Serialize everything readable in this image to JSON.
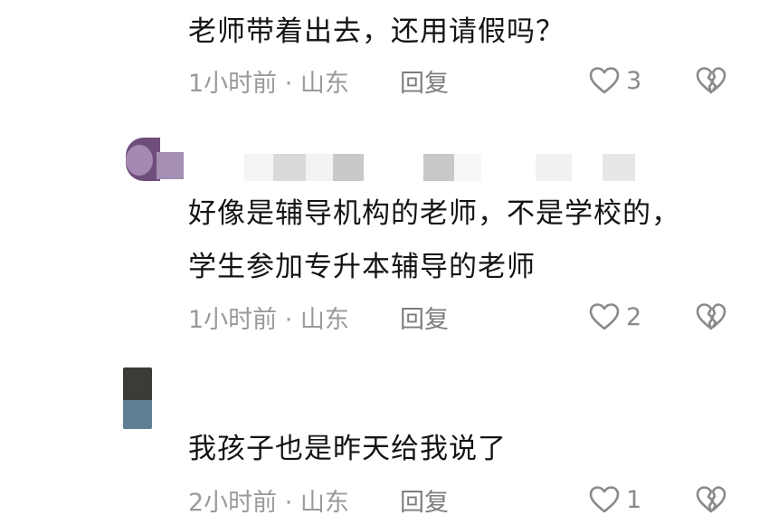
{
  "comments": [
    {
      "text_lines": [
        "老师带着出去，还用请假吗？"
      ],
      "time_location": "1小时前 · 山东",
      "reply_label": "回复",
      "like_count": "3"
    },
    {
      "text_lines": [
        "好像是辅导机构的老师，不是学校的，",
        "学生参加专升本辅导的老师"
      ],
      "time_location": "1小时前 · 山东",
      "reply_label": "回复",
      "like_count": "2"
    },
    {
      "text_lines": [
        "我孩子也是昨天给我说了"
      ],
      "time_location": "2小时前 · 山东",
      "reply_label": "回复",
      "like_count": "1"
    }
  ],
  "icons": {
    "like": "heart-outline-icon",
    "dislike": "broken-heart-icon"
  },
  "colors": {
    "text": "#141414",
    "meta": "#9a9a9a",
    "icon": "#8a8a8a"
  }
}
